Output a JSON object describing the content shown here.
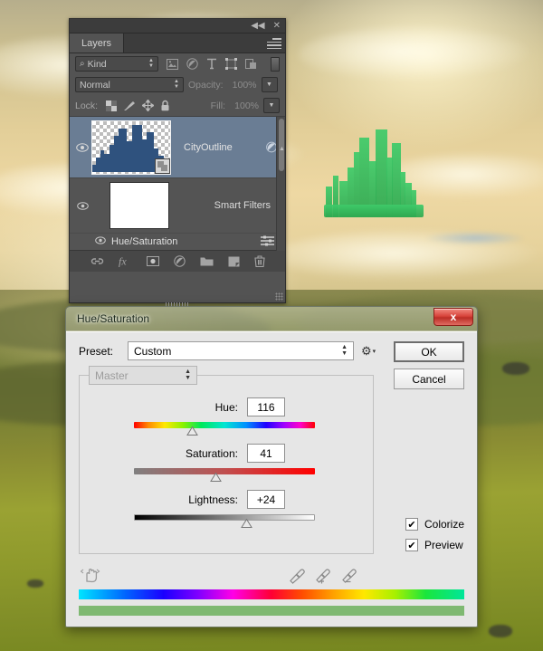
{
  "app": "Adobe Photoshop",
  "layers_panel": {
    "tab_label": "Layers",
    "collapse_icon": "collapse-double-arrow-icon",
    "close_icon": "close-icon",
    "menu_icon": "panel-menu-icon",
    "filter": {
      "kind_label": "Kind",
      "search_icon": "magnifier-icon",
      "icons": [
        "pixel-layer-filter-icon",
        "adjustment-layer-filter-icon",
        "type-layer-filter-icon",
        "shape-layer-filter-icon",
        "smart-object-filter-icon"
      ],
      "toggle_icon": "filter-toggle-switch"
    },
    "blend": {
      "mode": "Normal",
      "opacity_label": "Opacity:",
      "opacity_value": "100%"
    },
    "lock": {
      "label": "Lock:",
      "icons": [
        "lock-transparency-icon",
        "lock-image-icon",
        "lock-position-icon",
        "lock-all-icon"
      ],
      "fill_label": "Fill:",
      "fill_value": "100%"
    },
    "rows": [
      {
        "name": "CityOutline",
        "visible": true,
        "selected": true,
        "thumb": "city-skyline-thumbnail",
        "badge": "smart-object-badge",
        "right_icon": "smart-filter-indicator-icon"
      },
      {
        "name": "Smart Filters",
        "visible": true,
        "selected": false,
        "thumb": "white-filter-mask-thumbnail"
      },
      {
        "name": "Hue/Saturation",
        "visible": true,
        "selected": false,
        "right_icon": "filter-settings-icon"
      }
    ],
    "bottom_icons": [
      "link-layers-icon",
      "layer-style-fx-icon",
      "add-layer-mask-icon",
      "new-adjustment-layer-icon",
      "new-group-icon",
      "new-layer-icon",
      "delete-layer-icon"
    ]
  },
  "dialog": {
    "title": "Hue/Saturation",
    "close_label": "x",
    "preset_label": "Preset:",
    "preset_value": "Custom",
    "gear_icon": "preset-options-gear-icon",
    "ok_label": "OK",
    "cancel_label": "Cancel",
    "channel_value": "Master",
    "sliders": [
      {
        "name": "hue",
        "label": "Hue:",
        "value": "116",
        "position_pct": 32
      },
      {
        "name": "saturation",
        "label": "Saturation:",
        "value": "41",
        "position_pct": 45
      },
      {
        "name": "lightness",
        "label": "Lightness:",
        "value": "+24",
        "position_pct": 62
      }
    ],
    "hand_icon": "scrubby-hand-icon",
    "droppers": [
      "eyedropper-icon",
      "eyedropper-add-icon",
      "eyedropper-subtract-icon"
    ],
    "checkboxes": [
      {
        "name": "colorize",
        "label": "Colorize",
        "checked": true,
        "mark": "✔"
      },
      {
        "name": "preview",
        "label": "Preview",
        "checked": true,
        "mark": "✔"
      }
    ],
    "colorbars": {
      "spectrum_name": "hue-spectrum-bar",
      "result_name": "adjusted-color-bar",
      "result_color": "#7fb972"
    }
  },
  "canvas": {
    "description": "emerald-green-city-skyline-over-golden-landscape",
    "city_color": "#35bb5c",
    "sky_color": "#e3cf99",
    "land_color": "#8a9233"
  }
}
